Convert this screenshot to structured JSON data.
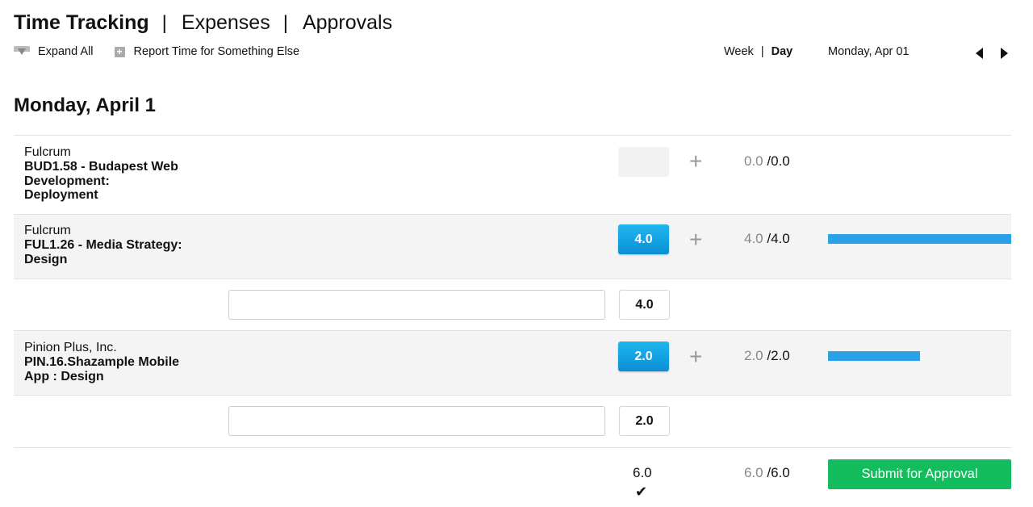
{
  "nav": {
    "tabs": [
      {
        "label": "Time Tracking",
        "active": true
      },
      {
        "label": "Expenses",
        "active": false
      },
      {
        "label": "Approvals",
        "active": false
      }
    ],
    "separator": "|"
  },
  "toolbar": {
    "expand_all": {
      "label": "Expand All",
      "icon": "expand-all-icon"
    },
    "report_other": {
      "label": "Report Time for Something Else",
      "icon": "add-icon"
    }
  },
  "view": {
    "week_label": "Week",
    "day_label": "Day",
    "active": "Day",
    "separator": "|",
    "date_label": "Monday, Apr 01",
    "prev_icon": "triangle-left-icon",
    "next_icon": "triangle-right-icon"
  },
  "day_title": "Monday, April 1",
  "entries": [
    {
      "client": "Fulcrum",
      "project_lines": [
        "BUD1.58 - Budapest Web",
        "Development:",
        "Deployment"
      ],
      "hours": "",
      "done": "0.0",
      "total": "0.0",
      "progress_fraction": 0,
      "expanded": false
    },
    {
      "client": "Fulcrum",
      "project_lines": [
        "FUL1.26 - Media Strategy:",
        "Design"
      ],
      "hours": "4.0",
      "done": "4.0",
      "total": "4.0",
      "progress_fraction": 1.0,
      "expanded": true,
      "note": {
        "value": "",
        "hours": "4.0"
      }
    },
    {
      "client": "Pinion Plus, Inc.",
      "project_lines": [
        "PIN.16.Shazample Mobile",
        "App : Design"
      ],
      "hours": "2.0",
      "done": "2.0",
      "total": "2.0",
      "progress_fraction": 0.5,
      "expanded": true,
      "note": {
        "value": "",
        "hours": "2.0"
      }
    }
  ],
  "footer": {
    "total_hours": "6.0",
    "check_icon": "checkmark-icon",
    "done": "6.0",
    "total": "6.0",
    "submit_label": "Submit for Approval"
  },
  "colors": {
    "accent_blue": "#1ba3e3",
    "progress_blue": "#2aa0e6",
    "submit_green": "#13bd5d"
  }
}
